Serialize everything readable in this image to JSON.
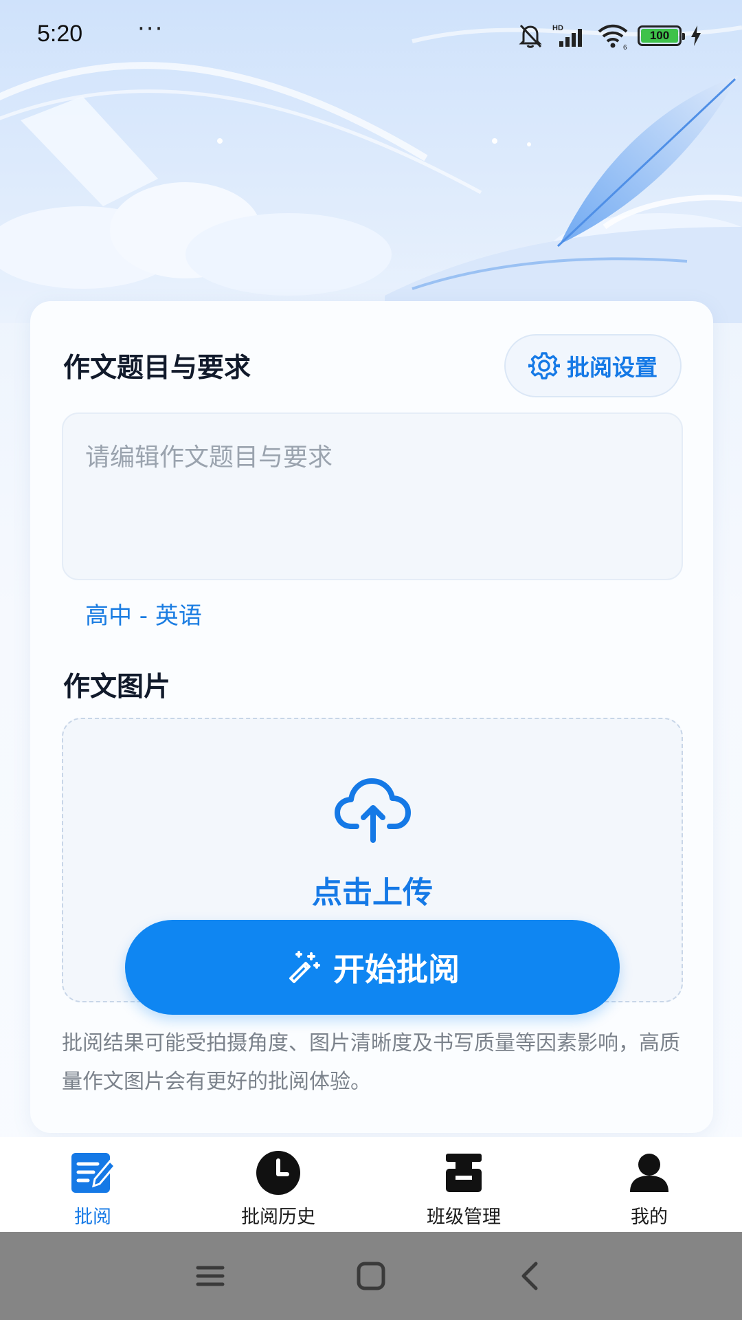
{
  "status_bar": {
    "time": "5:20",
    "dots": "···",
    "battery": "100"
  },
  "form": {
    "topic_section_title": "作文题目与要求",
    "settings_button_label": "批阅设置",
    "topic_placeholder": "请编辑作文题目与要求",
    "grade_subject": "高中 - 英语",
    "image_section_title": "作文图片",
    "upload_label": "点击上传",
    "start_button_label": "开始批阅",
    "notice": "批阅结果可能受拍摄角度、图片清晰度及书写质量等因素影响，高质量作文图片会有更好的批阅体验。"
  },
  "tabs": [
    {
      "label": "批阅",
      "icon": "edit-document-icon",
      "active": true
    },
    {
      "label": "批阅历史",
      "icon": "clock-icon",
      "active": false
    },
    {
      "label": "班级管理",
      "icon": "class-icon",
      "active": false
    },
    {
      "label": "我的",
      "icon": "user-icon",
      "active": false
    }
  ],
  "colors": {
    "accent": "#1579e6",
    "button": "#0f86f2",
    "title": "#111a2b",
    "muted": "#7b828b"
  }
}
